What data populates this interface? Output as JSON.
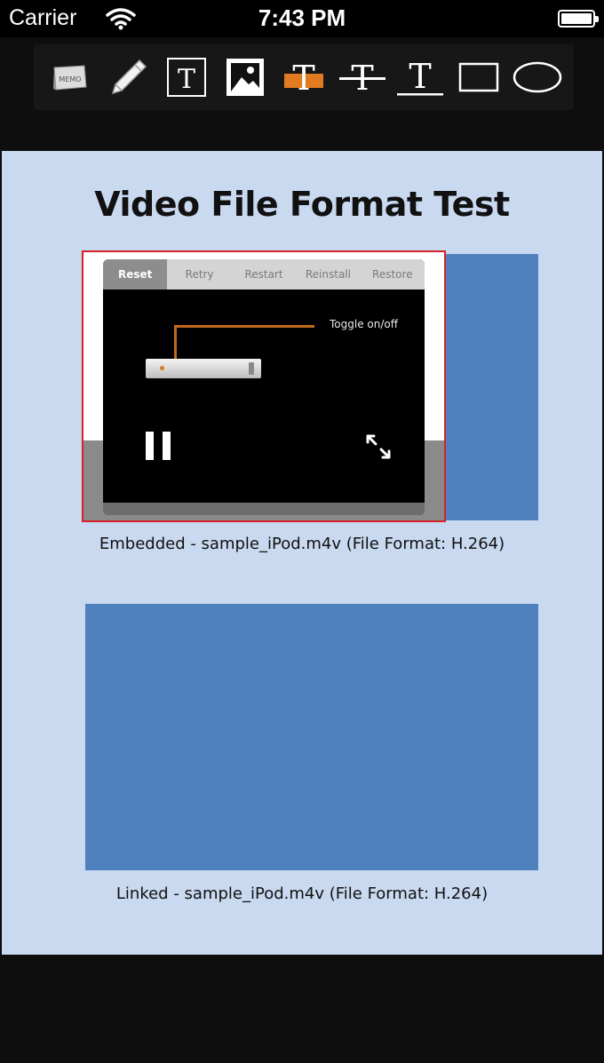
{
  "status_bar": {
    "carrier": "Carrier",
    "time": "7:43 PM",
    "icons": [
      "wifi-icon",
      "battery-icon"
    ]
  },
  "toolbar": {
    "tools": [
      {
        "name": "memo-tool",
        "label": "MEMO",
        "icon": "memo-note-icon"
      },
      {
        "name": "pencil-tool",
        "icon": "pencil-icon"
      },
      {
        "name": "text-box-tool",
        "label": "T",
        "icon": "text-box-icon"
      },
      {
        "name": "image-tool",
        "icon": "image-icon"
      },
      {
        "name": "highlight-tool",
        "label": "T",
        "icon": "highlight-text-icon",
        "color": "#e07b22"
      },
      {
        "name": "strikethrough-tool",
        "label": "T",
        "icon": "strikethrough-text-icon"
      },
      {
        "name": "underline-tool",
        "label": "T",
        "icon": "underline-text-icon"
      },
      {
        "name": "rectangle-tool",
        "icon": "rectangle-icon"
      },
      {
        "name": "ellipse-tool",
        "icon": "ellipse-icon"
      }
    ]
  },
  "page": {
    "title": "Video File Format Test",
    "embedded_caption": "Embedded - sample_iPod.m4v (File Format: H.264)",
    "linked_caption": "Linked - sample_iPod.m4v (File Format: H.264)"
  },
  "video": {
    "tabs": [
      {
        "label": "Reset",
        "active": true
      },
      {
        "label": "Retry",
        "active": false
      },
      {
        "label": "Restart",
        "active": false
      },
      {
        "label": "Reinstall",
        "active": false
      },
      {
        "label": "Restore",
        "active": false
      }
    ],
    "annotation": "Toggle on/off",
    "accent_color": "#c16a1e",
    "controls": [
      "pause-icon",
      "fullscreen-icon"
    ]
  },
  "colors": {
    "content_bg": "#c9d9f0",
    "placeholder_blue": "#4f81be",
    "frame_border": "#d8222a"
  }
}
